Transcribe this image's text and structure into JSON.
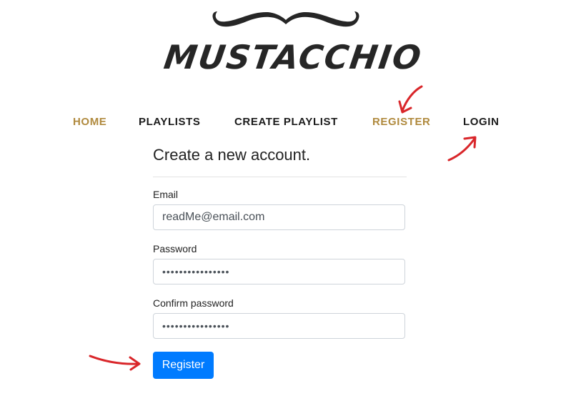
{
  "brand": {
    "name": "MUSTACCHIO"
  },
  "nav": {
    "home": "HOME",
    "playlists": "PLAYLISTS",
    "create_playlist": "CREATE PLAYLIST",
    "register": "REGISTER",
    "login": "LOGIN"
  },
  "form": {
    "title": "Create a new account.",
    "email_label": "Email",
    "email_value": "readMe@email.com",
    "password_label": "Password",
    "password_value": "••••••••••••••••",
    "confirm_label": "Confirm password",
    "confirm_value": "••••••••••••••••",
    "submit_label": "Register"
  },
  "colors": {
    "accent_gold": "#b08a3e",
    "button_blue": "#007bff",
    "annotation_red": "#d9262a"
  }
}
